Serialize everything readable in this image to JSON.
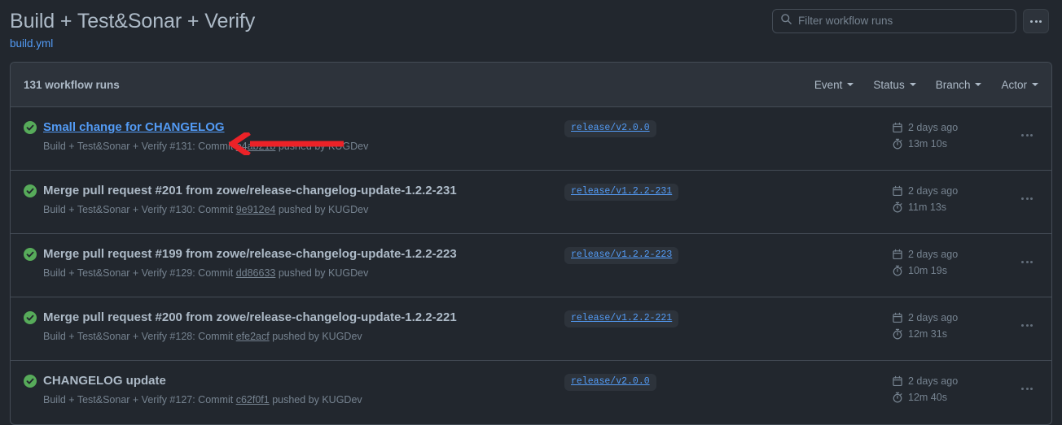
{
  "header": {
    "title": "Build + Test&Sonar + Verify",
    "workflow_file": "build.yml",
    "search": {
      "placeholder": "Filter workflow runs",
      "icon": "search-icon"
    },
    "more_button": "kebab-menu-icon"
  },
  "runs_panel": {
    "count_label": "131 workflow runs",
    "filters": [
      {
        "label": "Event",
        "icon": "chevron-down-icon"
      },
      {
        "label": "Status",
        "icon": "chevron-down-icon"
      },
      {
        "label": "Branch",
        "icon": "chevron-down-icon"
      },
      {
        "label": "Actor",
        "icon": "chevron-down-icon"
      }
    ],
    "runs": [
      {
        "status": "success",
        "status_icon": "check-circle-icon",
        "title": "Small change for CHANGELOG",
        "highlighted": true,
        "subtitle_prefix": "Build + Test&Sonar + Verify #131: Commit ",
        "commit": "b4ab21b",
        "subtitle_suffix": " pushed by KUGDev",
        "branch": "release/v2.0.0",
        "age": "2 days ago",
        "duration": "13m 10s",
        "calendar_icon": "calendar-icon",
        "stopwatch_icon": "stopwatch-icon",
        "row_menu": "kebab-menu-icon"
      },
      {
        "status": "success",
        "status_icon": "check-circle-icon",
        "title": "Merge pull request #201 from zowe/release-changelog-update-1.2.2-231",
        "highlighted": false,
        "subtitle_prefix": "Build + Test&Sonar + Verify #130: Commit ",
        "commit": "9e912e4",
        "subtitle_suffix": " pushed by KUGDev",
        "branch": "release/v1.2.2-231",
        "age": "2 days ago",
        "duration": "11m 13s",
        "calendar_icon": "calendar-icon",
        "stopwatch_icon": "stopwatch-icon",
        "row_menu": "kebab-menu-icon"
      },
      {
        "status": "success",
        "status_icon": "check-circle-icon",
        "title": "Merge pull request #199 from zowe/release-changelog-update-1.2.2-223",
        "highlighted": false,
        "subtitle_prefix": "Build + Test&Sonar + Verify #129: Commit ",
        "commit": "dd86633",
        "subtitle_suffix": " pushed by KUGDev",
        "branch": "release/v1.2.2-223",
        "age": "2 days ago",
        "duration": "10m 19s",
        "calendar_icon": "calendar-icon",
        "stopwatch_icon": "stopwatch-icon",
        "row_menu": "kebab-menu-icon"
      },
      {
        "status": "success",
        "status_icon": "check-circle-icon",
        "title": "Merge pull request #200 from zowe/release-changelog-update-1.2.2-221",
        "highlighted": false,
        "subtitle_prefix": "Build + Test&Sonar + Verify #128: Commit ",
        "commit": "efe2acf",
        "subtitle_suffix": " pushed by KUGDev",
        "branch": "release/v1.2.2-221",
        "age": "2 days ago",
        "duration": "12m 31s",
        "calendar_icon": "calendar-icon",
        "stopwatch_icon": "stopwatch-icon",
        "row_menu": "kebab-menu-icon"
      },
      {
        "status": "success",
        "status_icon": "check-circle-icon",
        "title": "CHANGELOG update",
        "highlighted": false,
        "subtitle_prefix": "Build + Test&Sonar + Verify #127: Commit ",
        "commit": "c62f0f1",
        "subtitle_suffix": " pushed by KUGDev",
        "branch": "release/v2.0.0",
        "age": "2 days ago",
        "duration": "12m 40s",
        "calendar_icon": "calendar-icon",
        "stopwatch_icon": "stopwatch-icon",
        "row_menu": "kebab-menu-icon"
      }
    ]
  },
  "annotation": {
    "type": "arrow-left",
    "color": "#ec2228",
    "points_at": "Small change for CHANGELOG"
  },
  "colors": {
    "background": "#22272e",
    "panel_header": "#2d333b",
    "border": "#444c56",
    "text": "#adbac7",
    "muted_text": "#768390",
    "link": "#539bf5",
    "success": "#57ab5a",
    "annotation": "#ec2228"
  }
}
